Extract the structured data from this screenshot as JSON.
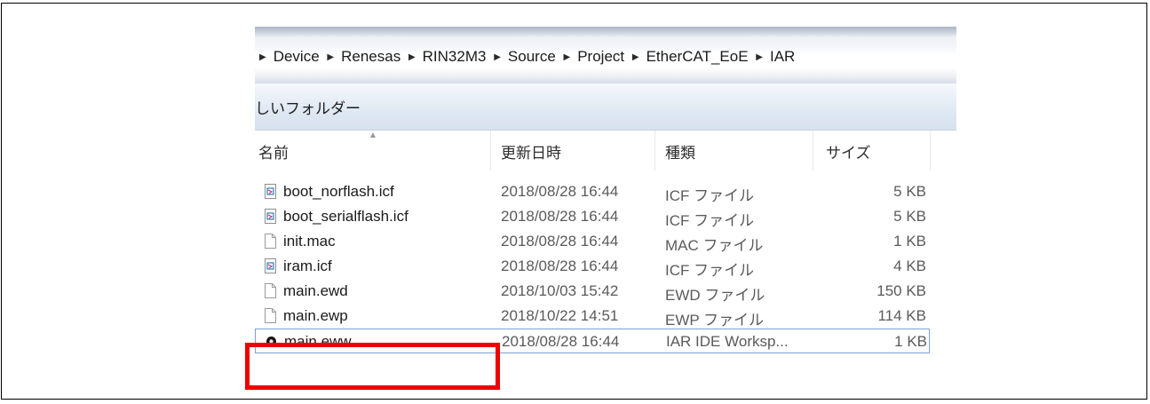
{
  "breadcrumb": [
    "Device",
    "Renesas",
    "RIN32M3",
    "Source",
    "Project",
    "EtherCAT_EoE",
    "IAR"
  ],
  "toolbar": {
    "new_folder_label": "しいフォルダー"
  },
  "columns": {
    "name": "名前",
    "date": "更新日時",
    "type": "種類",
    "size": "サイズ"
  },
  "files": [
    {
      "name": "boot_norflash.icf",
      "date": "2018/08/28 16:44",
      "type": "ICF ファイル",
      "size": "5 KB",
      "icon": "icf-file-icon"
    },
    {
      "name": "boot_serialflash.icf",
      "date": "2018/08/28 16:44",
      "type": "ICF ファイル",
      "size": "5 KB",
      "icon": "icf-file-icon"
    },
    {
      "name": "init.mac",
      "date": "2018/08/28 16:44",
      "type": "MAC ファイル",
      "size": "1 KB",
      "icon": "blank-file-icon"
    },
    {
      "name": "iram.icf",
      "date": "2018/08/28 16:44",
      "type": "ICF ファイル",
      "size": "4 KB",
      "icon": "icf-file-icon"
    },
    {
      "name": "main.ewd",
      "date": "2018/10/03 15:42",
      "type": "EWD ファイル",
      "size": "150 KB",
      "icon": "blank-file-icon"
    },
    {
      "name": "main.ewp",
      "date": "2018/10/22 14:51",
      "type": "EWP ファイル",
      "size": "114 KB",
      "icon": "blank-file-icon"
    },
    {
      "name": "main.eww",
      "date": "2018/08/28 16:44",
      "type": "IAR IDE Worksp...",
      "size": "1 KB",
      "icon": "iar-workspace-icon",
      "selected": true
    }
  ],
  "colors": {
    "highlight": "#ee0000",
    "selection_border": "#7da2ce"
  }
}
